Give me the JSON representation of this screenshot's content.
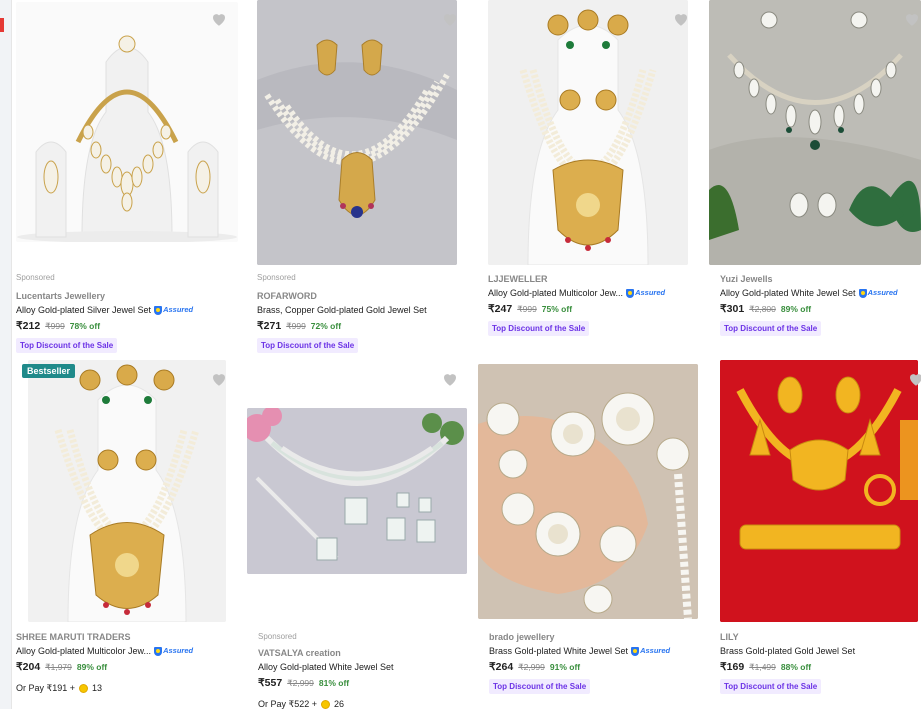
{
  "products": [
    {
      "sponsored": "Sponsored",
      "brand": "Lucentarts Jewellery",
      "title": "Alloy Gold-plated Silver Jewel Set",
      "assured": true,
      "price": "₹212",
      "mrp": "₹999",
      "off": "78% off",
      "tag": "Top Discount of the Sale",
      "wishlist_icon": "heart-icon"
    },
    {
      "sponsored": "Sponsored",
      "brand": "ROFARWORD",
      "title": "Brass, Copper Gold-plated Gold Jewel Set",
      "assured": false,
      "price": "₹271",
      "mrp": "₹999",
      "off": "72% off",
      "tag": "Top Discount of the Sale",
      "wishlist_icon": "heart-icon"
    },
    {
      "brand": "LJJEWELLER",
      "title": "Alloy Gold-plated Multicolor Jew...",
      "assured": true,
      "price": "₹247",
      "mrp": "₹999",
      "off": "75% off",
      "tag": "Top Discount of the Sale",
      "wishlist_icon": "heart-icon"
    },
    {
      "brand": "Yuzi Jewells",
      "title": "Alloy Gold-plated White Jewel Set",
      "assured": true,
      "price": "₹301",
      "mrp": "₹2,800",
      "off": "89% off",
      "tag": "Top Discount of the Sale",
      "wishlist_icon": "heart-icon"
    },
    {
      "badge": "Bestseller",
      "brand": "SHREE MARUTI TRADERS",
      "title": "Alloy Gold-plated Multicolor Jew...",
      "assured": true,
      "price": "₹204",
      "mrp": "₹1,979",
      "off": "89% off",
      "pay_prefix": "Or Pay ₹191 +",
      "coins": "13",
      "wishlist_icon": "heart-icon"
    },
    {
      "sponsored": "Sponsored",
      "brand": "VATSALYA creation",
      "title": "Alloy Gold-plated White Jewel Set",
      "assured": false,
      "price": "₹557",
      "mrp": "₹2,999",
      "off": "81% off",
      "pay_prefix": "Or Pay ₹522 +",
      "coins": "26",
      "wishlist_icon": "heart-icon"
    },
    {
      "brand": "brado jewellery",
      "title": "Brass Gold-plated White Jewel Set",
      "assured": true,
      "price": "₹264",
      "mrp": "₹2,999",
      "off": "91% off",
      "tag": "Top Discount of the Sale",
      "wishlist_icon": "heart-icon"
    },
    {
      "brand": "LILY",
      "title": "Brass Gold-plated Gold Jewel Set",
      "assured": false,
      "price": "₹169",
      "mrp": "₹1,499",
      "off": "88% off",
      "tag": "Top Discount of the Sale",
      "wishlist_icon": "heart-icon"
    }
  ],
  "assured_label": "Assured",
  "colors": {
    "discount_green": "#388e3c",
    "tag_purple": "#6c33e6",
    "tag_bg": "#f1ebff",
    "assured_blue": "#2874f0",
    "bestseller_teal": "#1f8a8a"
  }
}
